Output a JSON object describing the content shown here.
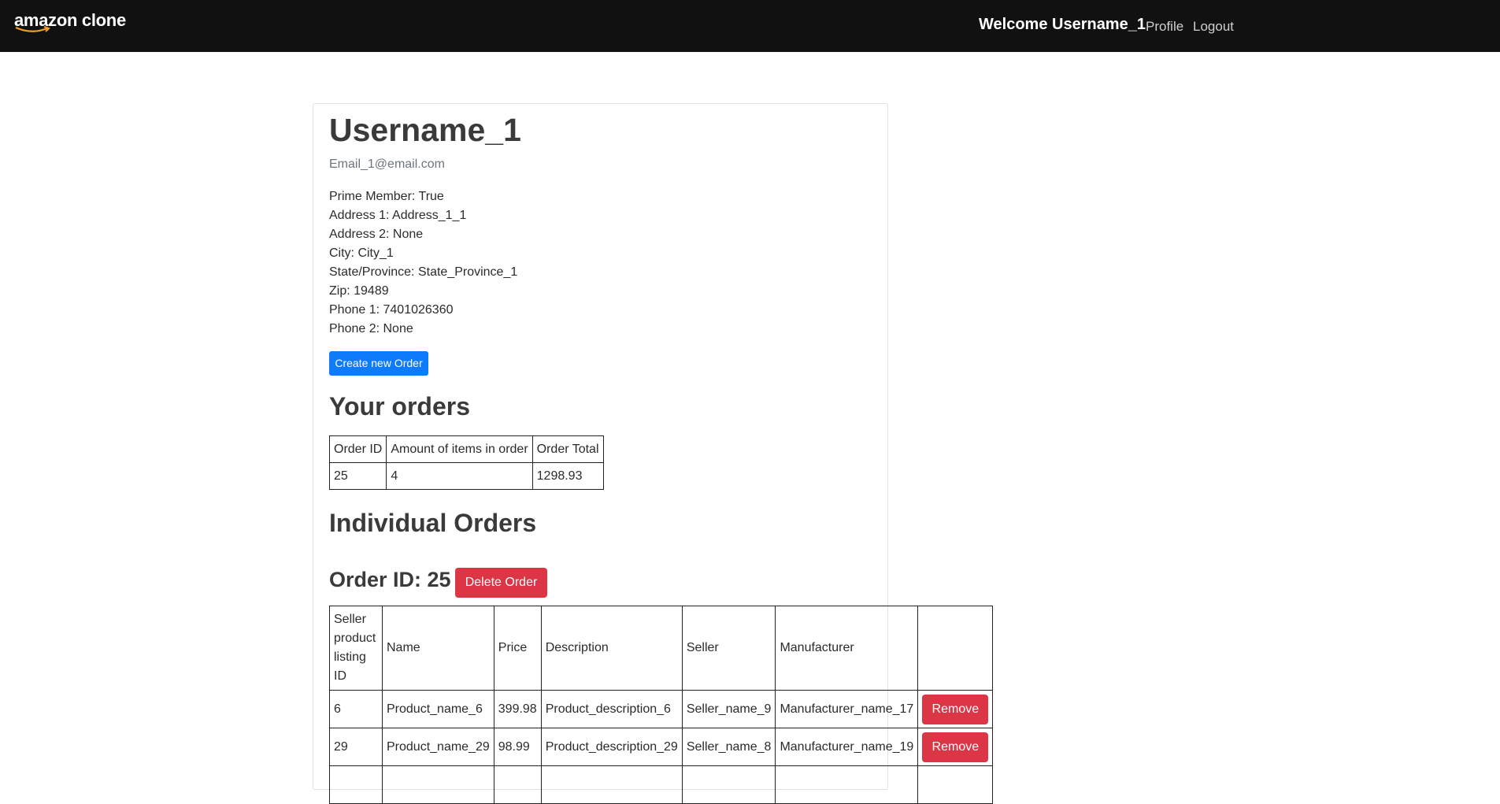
{
  "navbar": {
    "brand": "amazon clone",
    "welcome": "Welcome Username_1",
    "profile_link": "Profile",
    "logout_link": "Logout"
  },
  "profile": {
    "username": "Username_1",
    "email": "Email_1@email.com",
    "prime": "Prime Member: True",
    "address1": "Address 1: Address_1_1",
    "address2": "Address 2: None",
    "city": "City: City_1",
    "state": "State/Province: State_Province_1",
    "zip": "Zip: 19489",
    "phone1": "Phone 1: 7401026360",
    "phone2": "Phone 2: None",
    "create_order_label": "Create new Order"
  },
  "orders": {
    "heading": "Your orders",
    "columns": [
      "Order ID",
      "Amount of items in order",
      "Order Total"
    ],
    "rows": [
      [
        "25",
        "4",
        "1298.93"
      ]
    ]
  },
  "individual": {
    "heading": "Individual Orders",
    "order_title": "Order ID: 25",
    "delete_label": "Delete Order",
    "columns": [
      "Seller product listing ID",
      "Name",
      "Price",
      "Description",
      "Seller",
      "Manufacturer",
      ""
    ],
    "remove_label": "Remove",
    "rows": [
      [
        "6",
        "Product_name_6",
        "399.98",
        "Product_description_6",
        "Seller_name_9",
        "Manufacturer_name_17"
      ],
      [
        "29",
        "Product_name_29",
        "98.99",
        "Product_description_29",
        "Seller_name_8",
        "Manufacturer_name_19"
      ]
    ]
  }
}
